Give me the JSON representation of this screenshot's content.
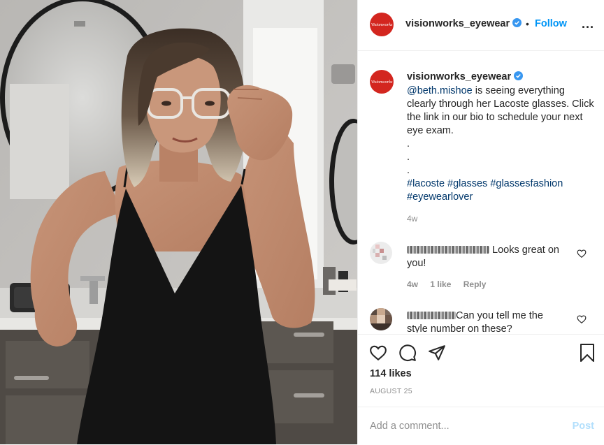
{
  "post": {
    "image_alt": "Woman in black dress adjusting clear-framed Lacoste glasses in a bathroom",
    "account": {
      "username": "visionworks_eyewear",
      "avatar_text": "Visionworks",
      "verified": true,
      "brand_color": "#d3261f"
    },
    "header": {
      "separator": "•",
      "follow_label": "Follow",
      "more_label": "..."
    },
    "caption": {
      "username": "visionworks_eyewear",
      "mention": "@beth.mishoe",
      "text": " is seeing everything clearly through her Lacoste glasses. Click the link in our bio to schedule your next eye exam.",
      "dots": [
        ".",
        ".",
        "."
      ],
      "hashtags": [
        "#lacoste",
        "#glasses",
        "#glassesfashion",
        "#eyewearlover"
      ],
      "time": "4w"
    },
    "comments": [
      {
        "text": "Looks great on you!",
        "time": "4w",
        "likes": "1 like",
        "reply": "Reply"
      },
      {
        "text": "Can you tell me the style number on these?"
      }
    ],
    "actions": {
      "icons": [
        "heart-icon",
        "comment-icon",
        "share-icon",
        "bookmark-icon"
      ]
    },
    "likes_label": "114 likes",
    "date_label": "AUGUST 25",
    "comment_input": {
      "placeholder": "Add a comment...",
      "post_label": "Post"
    },
    "colors": {
      "link_blue": "#0095f6",
      "hashtag_blue": "#00376b",
      "muted": "#8e8e8e",
      "post_disabled": "#b2dffc"
    }
  }
}
